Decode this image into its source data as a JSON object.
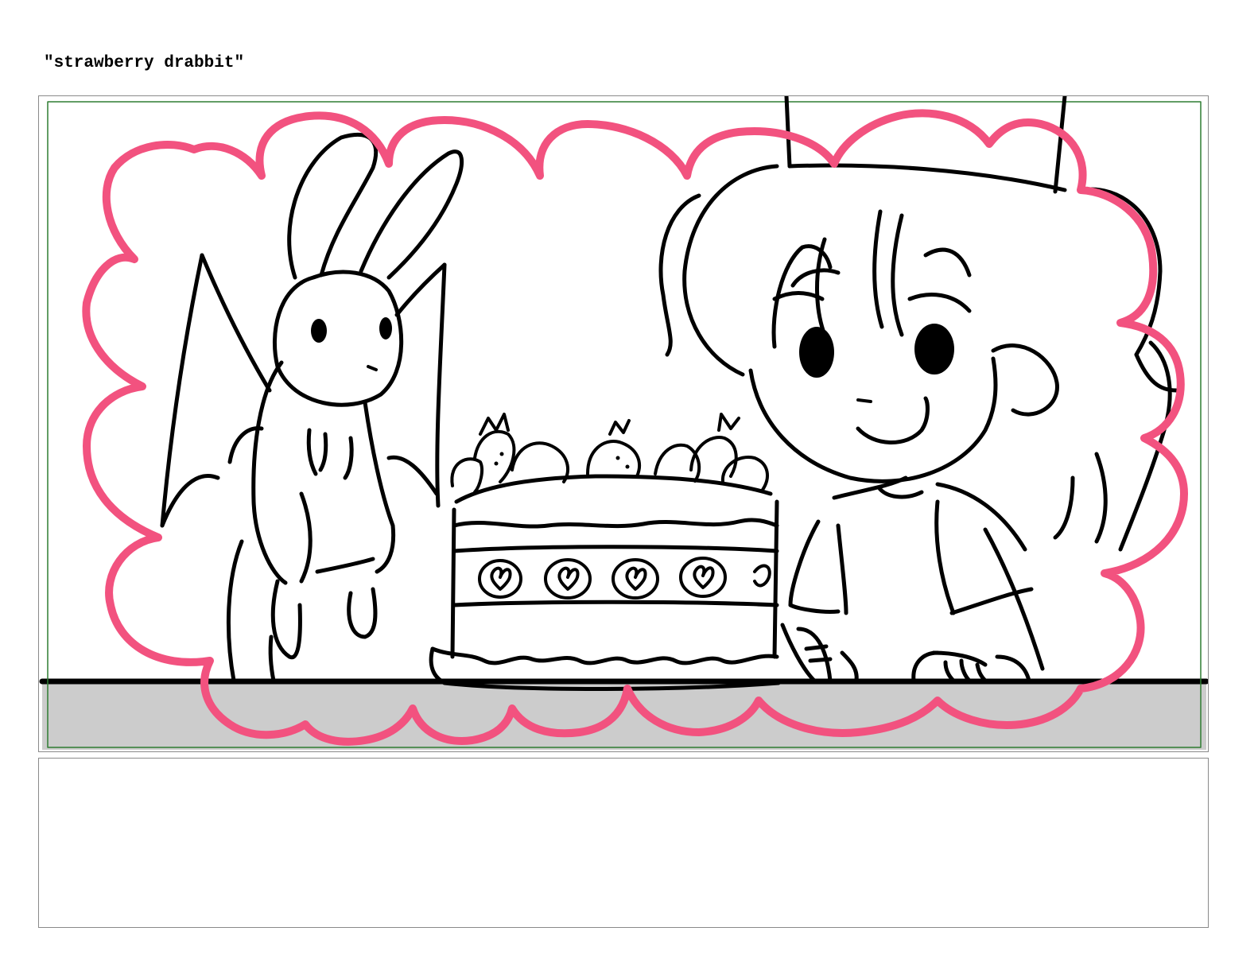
{
  "board": {
    "title": "\"strawberry drabbit\"",
    "notes_text": ""
  },
  "colors": {
    "outline": "#000000",
    "dream_cloud": "#f2527f",
    "safe_frame": "#2e7d32",
    "table_surface": "#cccccc",
    "panel_border": "#8a8a8a"
  }
}
